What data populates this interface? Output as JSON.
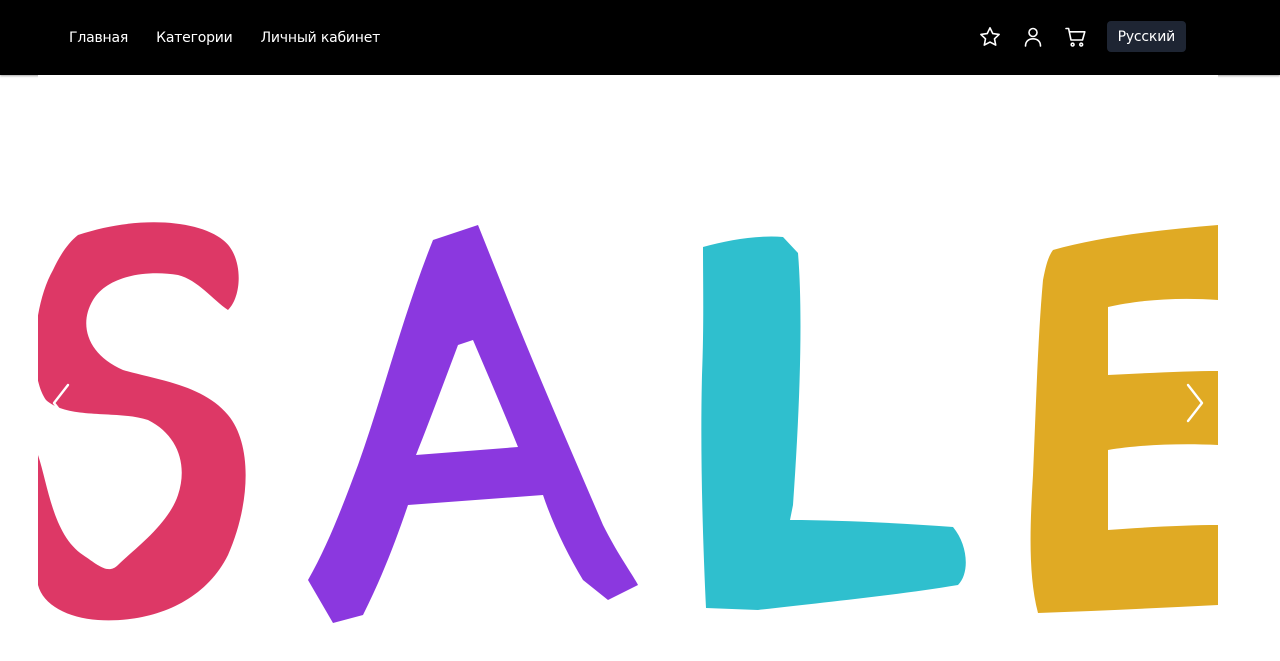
{
  "header": {
    "nav": [
      {
        "label": "Главная"
      },
      {
        "label": "Категории"
      },
      {
        "label": "Личный кабинет"
      }
    ],
    "icons": [
      "star-icon",
      "user-icon",
      "cart-icon"
    ],
    "language_button": "Русский"
  },
  "banner": {
    "letters": [
      "S",
      "A",
      "L",
      "E"
    ],
    "colors": {
      "s": "#dd3866",
      "a": "#8b38df",
      "l": "#2fbfce",
      "e": "#e0aa24"
    },
    "prev_icon": "chevron-left-icon",
    "next_icon": "chevron-right-icon"
  },
  "theme": {
    "header_bg": "#000000",
    "lang_button_bg": "#1e2533"
  }
}
